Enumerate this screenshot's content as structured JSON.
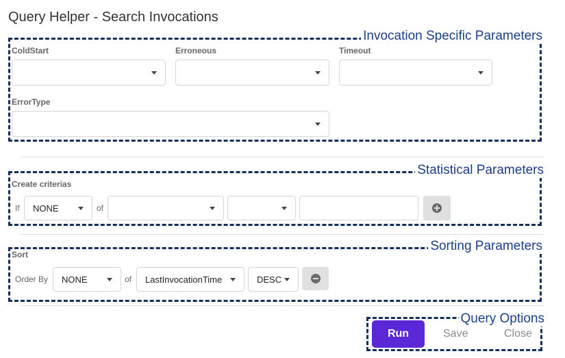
{
  "title": "Query Helper - Search Invocations",
  "groups": {
    "invocation": "Invocation Specific Parameters",
    "statistical": "Statistical Parameters",
    "sorting": "Sorting Parameters",
    "options": "Query Options"
  },
  "invocation": {
    "coldstart_label": "ColdStart",
    "coldstart_value": "",
    "erroneous_label": "Erroneous",
    "erroneous_value": "",
    "timeout_label": "Timeout",
    "timeout_value": "",
    "errortype_label": "ErrorType",
    "errortype_value": ""
  },
  "statistical": {
    "label": "Create criterias",
    "if_label": "If",
    "function_value": "NONE",
    "of_label": "of",
    "field_value": "",
    "operator_value": "",
    "value_input": ""
  },
  "sorting": {
    "label": "Sort",
    "order_by_label": "Order By",
    "function_value": "NONE",
    "of_label": "of",
    "field_value": "LastInvocationTime",
    "direction_value": "DESC"
  },
  "options": {
    "run_label": "Run",
    "save_label": "Save",
    "close_label": "Close"
  },
  "colors": {
    "accent": "#5a28d6",
    "group_border": "#102f5e",
    "group_label": "#1c3f8a"
  }
}
